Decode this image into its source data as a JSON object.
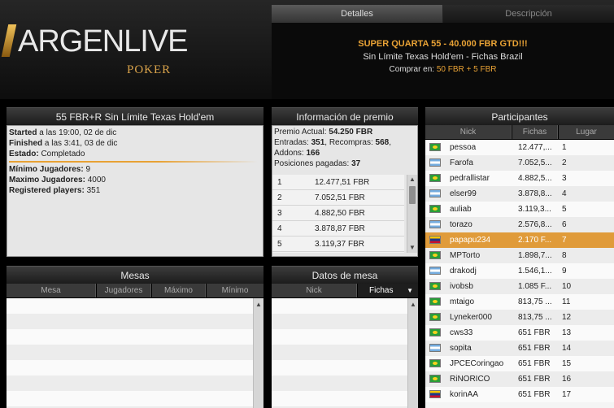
{
  "brand": {
    "name": "ARGENLIVE",
    "sub": "POKER"
  },
  "tabs": [
    {
      "label": "Detalles"
    },
    {
      "label": "Descripción"
    }
  ],
  "details": {
    "title": "SUPER QUARTA 55 - 40.000 FBR GTD!!!",
    "game": "Sin Límite Texas Hold'em - Fichas Brazil",
    "buyin_label": "Comprar en:",
    "buyin_value": "50 FBR + 5 FBR"
  },
  "tournament": {
    "title": "55 FBR+R Sin Límite Texas Hold'em",
    "started_label": "Started",
    "started_value": "a las 19:00, 02 de dic",
    "finished_label": "Finished",
    "finished_value": "a las 3:41, 03 de dic",
    "status_label": "Estado:",
    "status_value": "Completado",
    "min_label": "Mínimo Jugadores:",
    "min_value": "9",
    "max_label": "Maximo Jugadores:",
    "max_value": "4000",
    "reg_label": "Registered players:",
    "reg_value": "351"
  },
  "prize": {
    "title": "Información de premio",
    "current_label": "Premio Actual:",
    "current_value": "54.250 FBR",
    "entries_label": "Entradas:",
    "entries_value": "351",
    "rebuys_label": ", Recompras:",
    "rebuys_value": "568",
    "addons_label": "Addons:",
    "addons_value": "166",
    "paid_label": "Posiciones pagadas:",
    "paid_value": "37",
    "rows": [
      {
        "pos": "1",
        "amount": "12.477,51 FBR"
      },
      {
        "pos": "2",
        "amount": "7.052,51 FBR"
      },
      {
        "pos": "3",
        "amount": "4.882,50 FBR"
      },
      {
        "pos": "4",
        "amount": "3.878,87 FBR"
      },
      {
        "pos": "5",
        "amount": "3.119,37 FBR"
      }
    ]
  },
  "tables": {
    "title": "Mesas",
    "columns": [
      "Mesa",
      "Jugadores",
      "Máximo",
      "Mínimo"
    ]
  },
  "table_data": {
    "title": "Datos de mesa",
    "columns": [
      "Nick",
      "Fichas"
    ]
  },
  "participants": {
    "title": "Participantes",
    "columns": [
      "Nick",
      "Fichas",
      "Lugar"
    ],
    "rows": [
      {
        "flag": "br",
        "nick": "pessoa",
        "chips": "12.477,...",
        "place": "1"
      },
      {
        "flag": "ar",
        "nick": "Farofa",
        "chips": "7.052,5...",
        "place": "2"
      },
      {
        "flag": "br",
        "nick": "pedrallistar",
        "chips": "4.882,5...",
        "place": "3"
      },
      {
        "flag": "ar",
        "nick": "elser99",
        "chips": "3.878,8...",
        "place": "4"
      },
      {
        "flag": "br",
        "nick": "auliab",
        "chips": "3.119,3...",
        "place": "5"
      },
      {
        "flag": "ar",
        "nick": "torazo",
        "chips": "2.576,8...",
        "place": "6"
      },
      {
        "flag": "ve",
        "nick": "papapu234",
        "chips": "2.170 F...",
        "place": "7",
        "highlight": true
      },
      {
        "flag": "br",
        "nick": "MPTorto",
        "chips": "1.898,7...",
        "place": "8"
      },
      {
        "flag": "ar",
        "nick": "drakodj",
        "chips": "1.546,1...",
        "place": "9"
      },
      {
        "flag": "br",
        "nick": "ivobsb",
        "chips": "1.085 F...",
        "place": "10"
      },
      {
        "flag": "br",
        "nick": "mtaigo",
        "chips": "813,75 ...",
        "place": "11"
      },
      {
        "flag": "br",
        "nick": "Lyneker000",
        "chips": "813,75 ...",
        "place": "12"
      },
      {
        "flag": "br",
        "nick": "cws33",
        "chips": "651 FBR",
        "place": "13"
      },
      {
        "flag": "ar",
        "nick": "sopita",
        "chips": "651 FBR",
        "place": "14"
      },
      {
        "flag": "br",
        "nick": "JPCECoringao",
        "chips": "651 FBR",
        "place": "15"
      },
      {
        "flag": "br",
        "nick": "RiNORICO",
        "chips": "651 FBR",
        "place": "16"
      },
      {
        "flag": "ve",
        "nick": "korinAA",
        "chips": "651 FBR",
        "place": "17"
      }
    ]
  },
  "colors": {
    "accent": "#e8a235",
    "highlight_row": "#e09b3a"
  }
}
